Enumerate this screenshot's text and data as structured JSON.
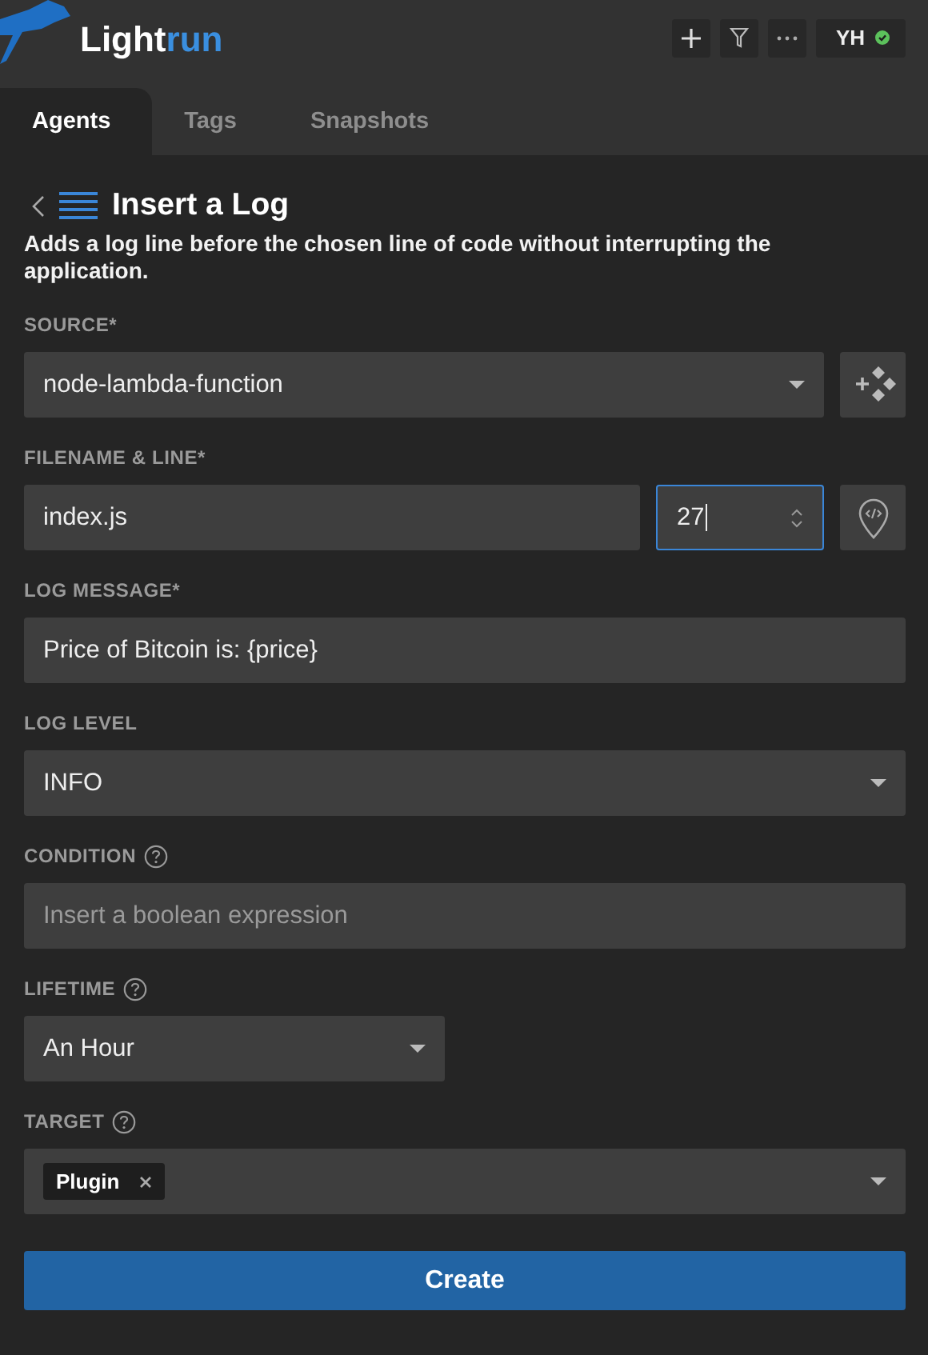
{
  "header": {
    "logo": {
      "text": "Light",
      "accent": "run"
    },
    "user": {
      "initials": "YH",
      "online": true
    }
  },
  "tabs": [
    {
      "label": "Agents",
      "selected": true
    },
    {
      "label": "Tags",
      "selected": false
    },
    {
      "label": "Snapshots",
      "selected": false
    }
  ],
  "form": {
    "title": "Insert a Log",
    "description": "Adds a log line before the chosen line of code without interrupting the application.",
    "fields": [
      {
        "kind": "select",
        "label": "SOURCE*",
        "value": "node-lambda-function",
        "side_button": true
      },
      {
        "kind": "file_line",
        "label": "FILENAME & LINE*",
        "value": "index.js",
        "line": "27",
        "line_focused": true,
        "side_button": true
      },
      {
        "kind": "text",
        "label": "LOG MESSAGE*",
        "value": "Price of Bitcoin is: {price}"
      },
      {
        "kind": "select",
        "label": "LOG LEVEL",
        "value": "INFO"
      },
      {
        "kind": "text",
        "label": "CONDITION",
        "help": true,
        "placeholder": "Insert a boolean expression"
      },
      {
        "kind": "short_select",
        "label": "LIFETIME",
        "help": true,
        "value": "An Hour"
      },
      {
        "kind": "tags",
        "label": "TARGET",
        "help": true,
        "tags": [
          "Plugin"
        ]
      }
    ],
    "submit": "Create"
  }
}
